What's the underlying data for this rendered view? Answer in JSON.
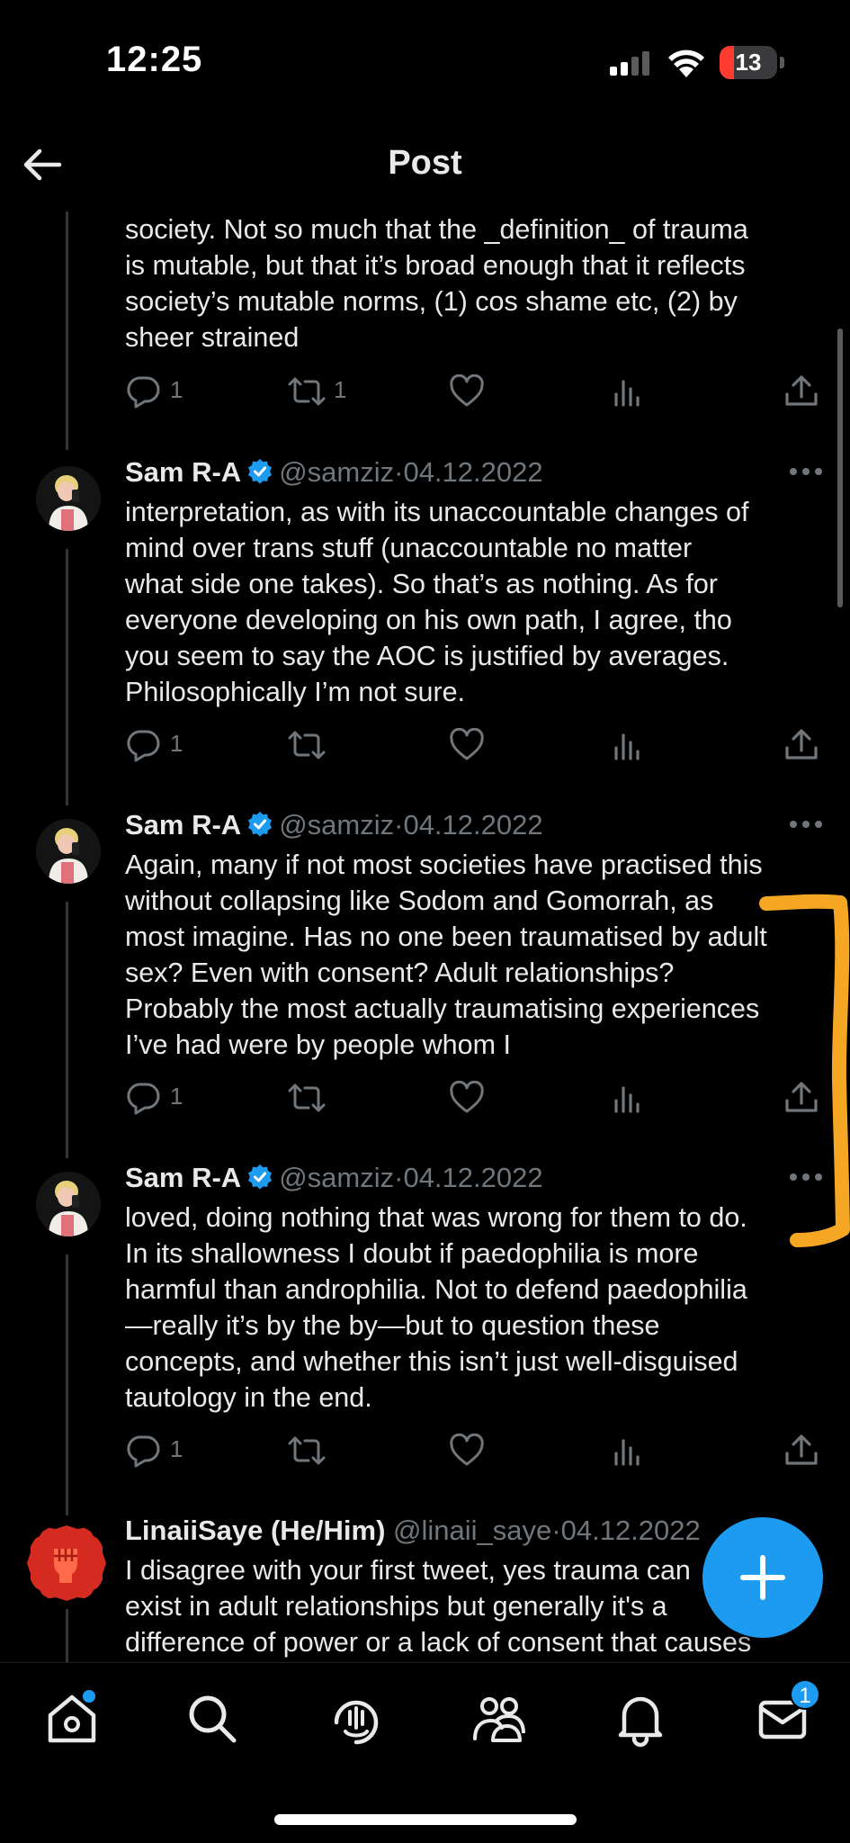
{
  "status_bar": {
    "time": "12:25",
    "battery": "13"
  },
  "header": {
    "title": "Post",
    "back_icon": "arrow-left-icon"
  },
  "tweets": [
    {
      "text": "society. Not so much that the _definition_ of trauma is mutable, but that it’s broad enough that it reflects society’s mutable norms, (1) cos shame etc, (2) by sheer strained",
      "lines": [
        "society. Not so much that the _definition_ of trauma",
        "is mutable, but that it’s broad enough that it reflects",
        "society’s mutable norms, (1) cos shame etc, (2) by",
        "sheer strained"
      ],
      "replies": "1",
      "reposts": "1"
    },
    {
      "name": "Sam R-A",
      "handle": "@samziz",
      "dot": "·",
      "date": "04.12.2022",
      "lines": [
        "interpretation, as with its unaccountable changes of",
        "mind over trans stuff (unaccountable no matter",
        "what side one takes). So that’s as nothing. As for",
        "everyone developing on his own path, I agree, tho",
        "you seem to say the AOC is justified by averages.",
        "Philosophically I’m not sure."
      ],
      "replies": "1",
      "reposts": ""
    },
    {
      "name": "Sam R-A",
      "handle": "@samziz",
      "dot": "·",
      "date": "04.12.2022",
      "lines": [
        "Again, many if not most societies have practised this",
        "without collapsing like Sodom and Gomorrah, as",
        "most imagine. Has no one been traumatised by adult",
        "sex? Even with consent? Adult relationships?",
        "Probably the most actually traumatising experiences",
        "I’ve had were by people whom I"
      ],
      "replies": "1",
      "reposts": ""
    },
    {
      "name": "Sam R-A",
      "handle": "@samziz",
      "dot": "·",
      "date": "04.12.2022",
      "lines": [
        "loved, doing nothing that was wrong for them to do.",
        "In its shallowness I doubt if paedophilia is more",
        "harmful than androphilia. Not to defend paedophilia",
        "—really it’s by the by—but to question these",
        "concepts, and whether this isn’t just well-disguised",
        "tautology in the end."
      ],
      "replies": "1",
      "reposts": ""
    },
    {
      "name": "LinaiiSaye (He/Him)",
      "handle": "@linaii_saye",
      "dot": "·",
      "date": "04.12.2022",
      "lines": [
        "I disagree with your first tweet, yes trauma can",
        "exist in adult relationships but generally it's a",
        "difference of power or a lack of consent that causes"
      ]
    }
  ],
  "icons": {
    "reply": "reply-icon",
    "repost": "repost-icon",
    "like": "heart-icon",
    "views": "views-icon",
    "share": "share-icon",
    "more": "more-icon",
    "verified": "verified-badge-icon"
  },
  "bottom_nav": {
    "items": [
      "home-icon",
      "search-icon",
      "spaces-icon",
      "communities-icon",
      "notifications-icon",
      "messages-icon"
    ],
    "messages_badge": "1"
  },
  "colors": {
    "accent": "#1d9bf0",
    "annotation": "#f5a623",
    "text": "#e7e9ea",
    "muted": "#71767b"
  }
}
